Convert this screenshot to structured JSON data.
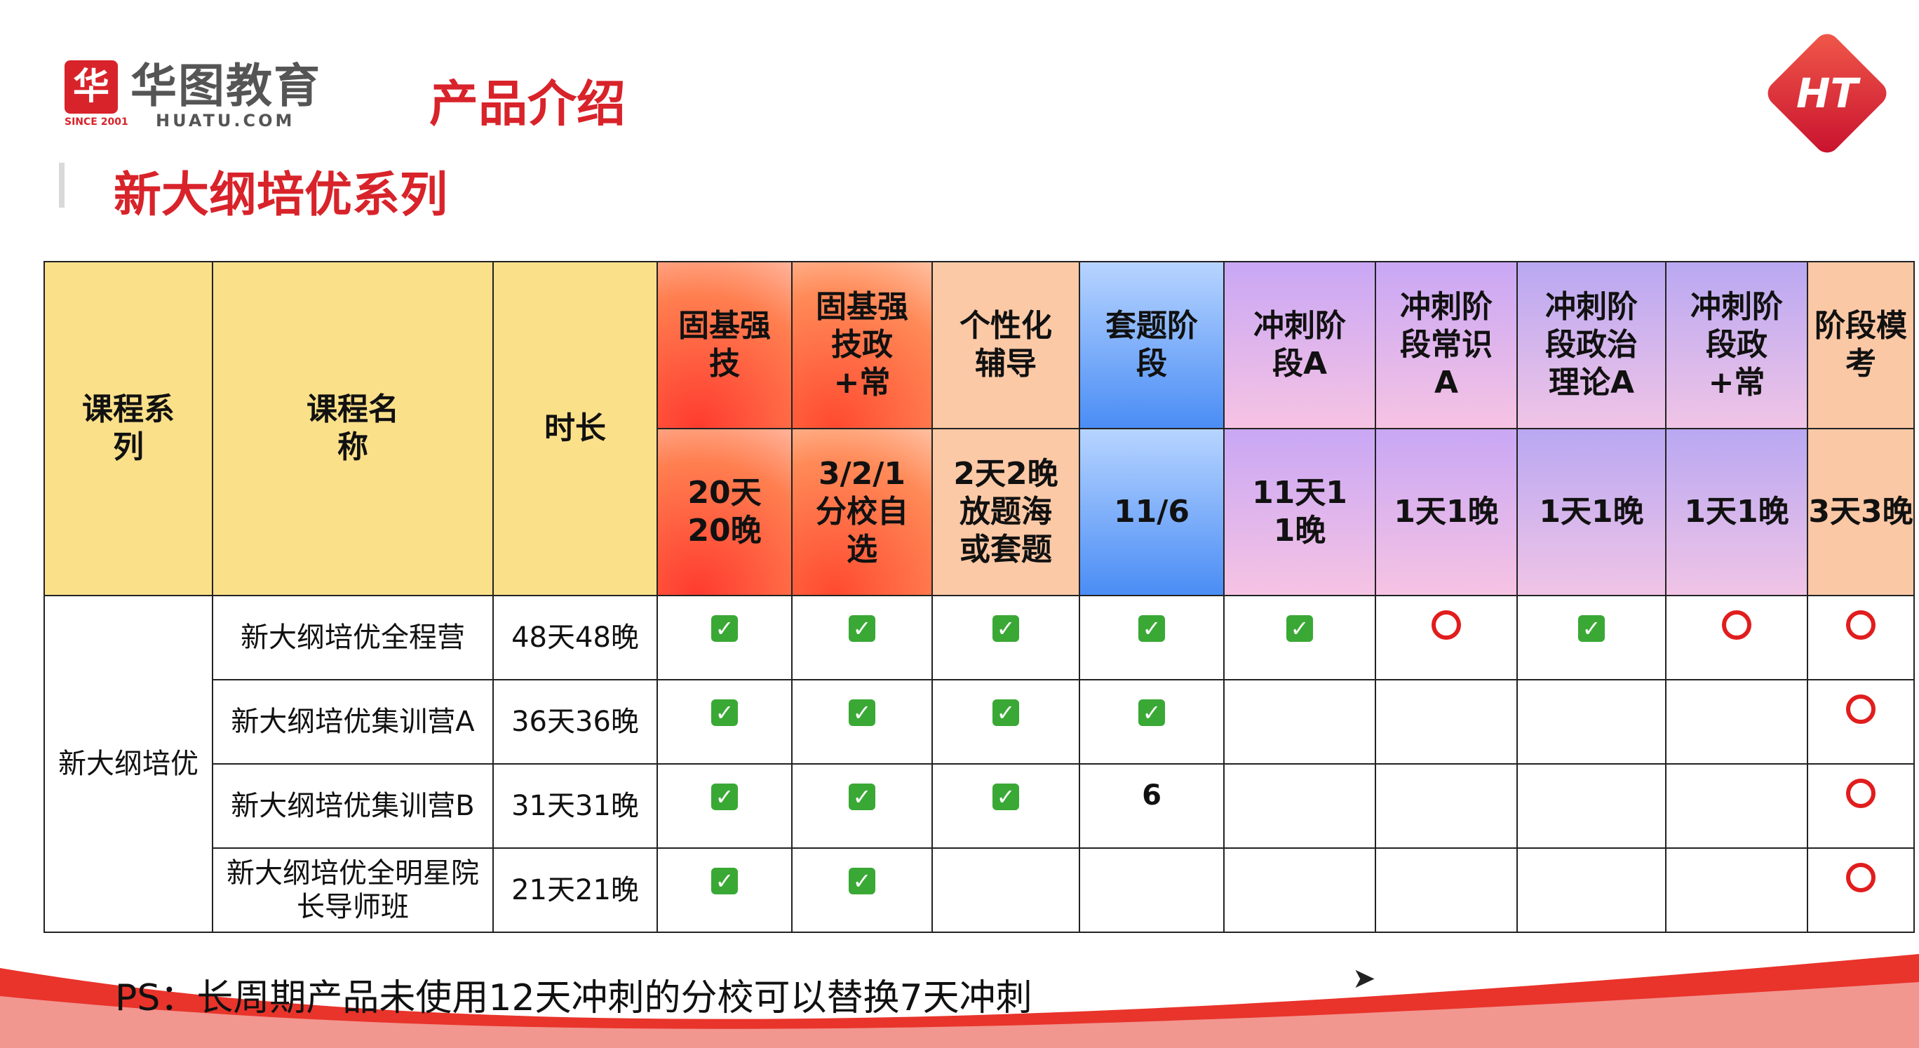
{
  "header": {
    "logo_cn": "华图教育",
    "logo_en": "HUATU.COM",
    "logo_since": "SINCE 2001",
    "page_title": "产品介绍",
    "section_title": "新大纲培优系列",
    "badge": "HT"
  },
  "table": {
    "col_series": "课程系列",
    "col_name": "课程名称",
    "col_duration": "时长",
    "stages": [
      {
        "title": "固基强技",
        "detail": "20天\n20晚"
      },
      {
        "title": "固基强技政+常",
        "detail": "3/2/1分校自选"
      },
      {
        "title": "个性化辅导",
        "detail": "2天2晚放题海或套题"
      },
      {
        "title": "套题阶段",
        "detail": "11/6"
      },
      {
        "title": "冲刺阶段A",
        "detail": "11天11晚"
      },
      {
        "title": "冲刺阶段常识A",
        "detail": "1天1晚"
      },
      {
        "title": "冲刺阶段政治理论A",
        "detail": "1天1晚"
      },
      {
        "title": "冲刺阶段政+常",
        "detail": "1天1晚"
      },
      {
        "title": "阶段模考",
        "detail": "3天3晚"
      }
    ],
    "series_name": "新大纲培优",
    "rows": [
      {
        "name": "新大纲培优全程营",
        "duration": "48天48晚",
        "marks": [
          "check",
          "check",
          "check",
          "check",
          "check",
          "circle",
          "check",
          "circle",
          "circle"
        ]
      },
      {
        "name": "新大纲培优集训营A",
        "duration": "36天36晚",
        "marks": [
          "check",
          "check",
          "check",
          "check",
          "",
          "",
          "",
          "",
          "circle"
        ]
      },
      {
        "name": "新大纲培优集训营B",
        "duration": "31天31晚",
        "marks": [
          "check",
          "check",
          "check",
          "6",
          "",
          "",
          "",
          "",
          "circle"
        ]
      },
      {
        "name": "新大纲培优全明星院长导师班",
        "duration": "21天21晚",
        "marks": [
          "check",
          "check",
          "",
          "",
          "",
          "",
          "",
          "",
          "circle"
        ]
      }
    ]
  },
  "footer": {
    "note": "PS：长周期产品未使用12天冲刺的分校可以替换7天冲刺"
  },
  "colors": {
    "brand_red": "#d8232a",
    "check_green": "#3aa835",
    "circle_red": "#e11d1d",
    "header_yellow": "#fbe08a"
  }
}
